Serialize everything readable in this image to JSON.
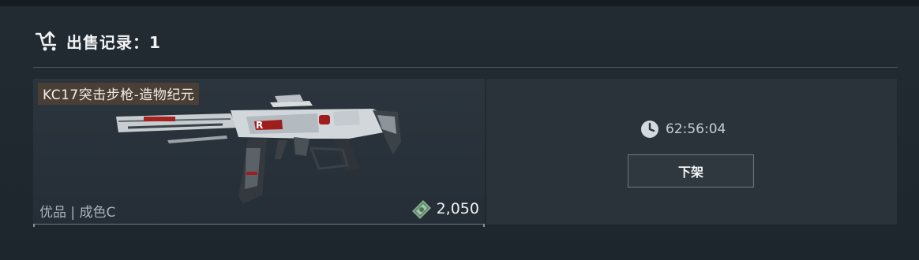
{
  "header": {
    "title": "出售记录：1",
    "icon": "cart-upload-icon"
  },
  "item": {
    "name": "KC17突击步枪-造物纪元",
    "quality": "优品 | 成色C",
    "price": "2,050",
    "currency_icon": "money-icon",
    "name_bg_color": "#4a3f36"
  },
  "listing": {
    "timer": "62:56:04",
    "timer_icon": "clock-icon",
    "delist_label": "下架"
  }
}
